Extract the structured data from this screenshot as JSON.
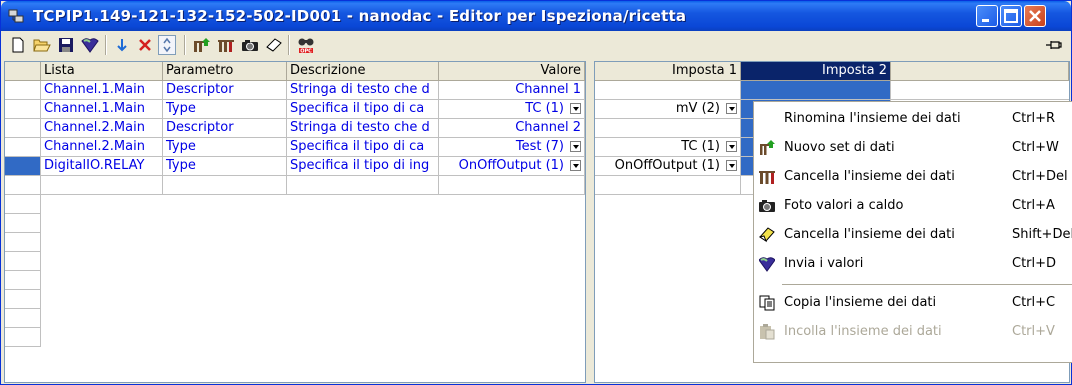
{
  "window": {
    "title": "TCPIP1.149-121-132-152-502-ID001 - nanodac - Editor per Ispeziona/ricetta"
  },
  "toolbar": {
    "icons": [
      "new-icon",
      "open-icon",
      "save-icon",
      "send-values-icon",
      "move-down-icon",
      "delete-icon",
      "sort-icon",
      "new-dataset-icon",
      "delete-dataset-icon",
      "snapshot-icon",
      "clear-icon",
      "opc-browse-icon",
      "pin-icon"
    ]
  },
  "left_grid": {
    "columns": [
      "Lista",
      "Parametro",
      "Descrizione",
      "Valore"
    ],
    "rows": [
      {
        "lista": "Channel.1.Main",
        "parametro": "Descriptor",
        "descrizione": "Stringa di testo che d",
        "valore": "Channel 1",
        "combo": false
      },
      {
        "lista": "Channel.1.Main",
        "parametro": "Type",
        "descrizione": "Specifica il tipo di ca",
        "valore": "TC (1)",
        "combo": true
      },
      {
        "lista": "Channel.2.Main",
        "parametro": "Descriptor",
        "descrizione": "Stringa di testo che d",
        "valore": "Channel 2",
        "combo": false
      },
      {
        "lista": "Channel.2.Main",
        "parametro": "Type",
        "descrizione": "Specifica il tipo di ca",
        "valore": "Test (7)",
        "combo": true
      },
      {
        "lista": "DigitalIO.RELAY",
        "parametro": "Type",
        "descrizione": "Specifica il tipo di ing",
        "valore": "OnOffOutput (1)",
        "combo": true
      }
    ]
  },
  "right_grid": {
    "columns": [
      "Imposta 1",
      "Imposta 2"
    ],
    "rows": [
      {
        "imposta1": "",
        "combo": false
      },
      {
        "imposta1": "mV (2)",
        "combo": true
      },
      {
        "imposta1": "",
        "combo": false
      },
      {
        "imposta1": "TC (1)",
        "combo": true
      },
      {
        "imposta1": "OnOffOutput (1)",
        "combo": true
      }
    ]
  },
  "context_menu": {
    "items": [
      {
        "icon": "",
        "label": "Rinomina l'insieme dei dati",
        "shortcut": "Ctrl+R",
        "disabled": false
      },
      {
        "icon": "new-dataset-icon",
        "label": "Nuovo set di dati",
        "shortcut": "Ctrl+W",
        "disabled": false
      },
      {
        "icon": "delete-dataset-icon",
        "label": "Cancella l'insieme dei dati",
        "shortcut": "Ctrl+Del",
        "disabled": false
      },
      {
        "icon": "camera-icon",
        "label": "Foto valori a caldo",
        "shortcut": "Ctrl+A",
        "disabled": false
      },
      {
        "icon": "eraser-icon",
        "label": "Cancella l'insieme dei dati",
        "shortcut": "Shift+Del",
        "disabled": false
      },
      {
        "icon": "send-icon",
        "label": "Invia i valori",
        "shortcut": "Ctrl+D",
        "disabled": false
      },
      {
        "icon": "copy-icon",
        "label": "Copia l'insieme dei dati",
        "shortcut": "Ctrl+C",
        "disabled": false
      },
      {
        "icon": "paste-icon",
        "label": "Incolla l'insieme dei dati",
        "shortcut": "Ctrl+V",
        "disabled": true
      }
    ]
  }
}
